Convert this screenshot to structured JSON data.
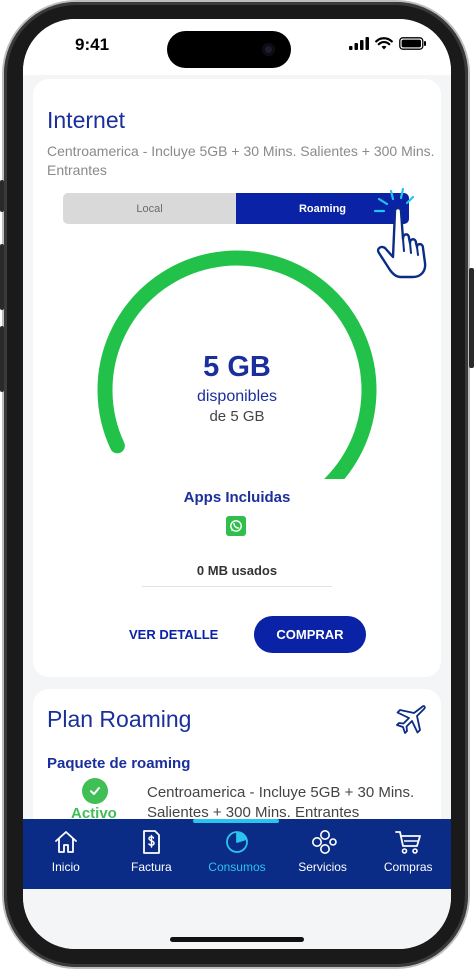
{
  "status_bar": {
    "time": "9:41"
  },
  "internet_card": {
    "title": "Internet",
    "description": "Centroamerica - Incluye 5GB + 30 Mins. Salientes + 300 Mins. Entrantes",
    "segment": {
      "options": [
        "Local",
        "Roaming"
      ],
      "selected": "Roaming"
    },
    "gauge": {
      "amount": "5 GB",
      "label": "disponibles",
      "total": "de 5 GB",
      "fill_fraction": 1.0,
      "color": "#22c24a"
    },
    "apps_title": "Apps Incluidas",
    "apps": [
      "whatsapp-icon"
    ],
    "usage": "0 MB usados",
    "detail_link": "VER DETALLE",
    "buy_button": "COMPRAR"
  },
  "roaming_card": {
    "title": "Plan Roaming",
    "package_title": "Paquete de roaming",
    "status": "Activo",
    "package_description": "Centroamerica - Incluye 5GB + 30 Mins. Salientes + 300 Mins. Entrantes"
  },
  "bottom_nav": {
    "items": [
      {
        "label": "Inicio",
        "icon": "home-icon"
      },
      {
        "label": "Factura",
        "icon": "invoice-icon"
      },
      {
        "label": "Consumos",
        "icon": "pie-chart-icon",
        "active": true
      },
      {
        "label": "Servicios",
        "icon": "services-icon"
      },
      {
        "label": "Compras",
        "icon": "cart-icon"
      }
    ]
  },
  "colors": {
    "brand_blue": "#0a22a6",
    "title_blue": "#1a2f9c",
    "nav_bg": "#0a2b86",
    "active_accent": "#2bc4ee",
    "success_green": "#3fbf55"
  }
}
